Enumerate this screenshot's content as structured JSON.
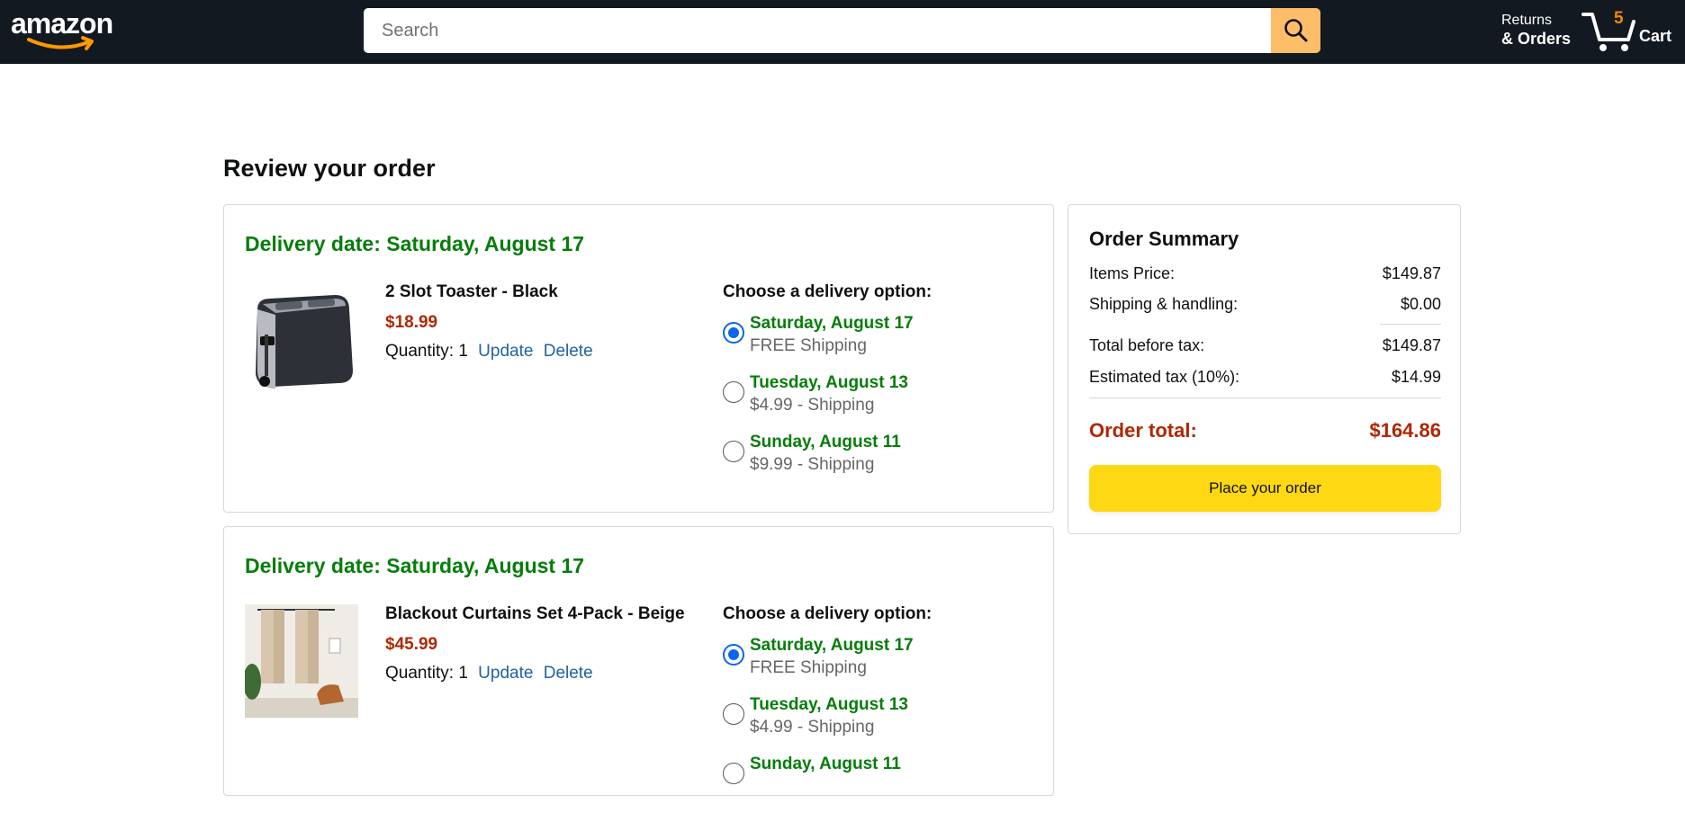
{
  "header": {
    "logo_text": "amazon",
    "search_placeholder": "Search",
    "returns_line1": "Returns",
    "returns_line2": "& Orders",
    "cart_count": "5",
    "cart_label": "Cart",
    "colors": {
      "bar": "#131921",
      "search_button": "#febd69",
      "cart_count": "#f08804"
    }
  },
  "page_title": "Review your order",
  "orders": [
    {
      "delivery_date": "Delivery date: Saturday, August 17",
      "product_name": "2 Slot Toaster - Black",
      "price": "$18.99",
      "quantity_label": "Quantity: 1",
      "update_label": "Update",
      "delete_label": "Delete",
      "image_icon": "toaster-image",
      "options_title": "Choose a delivery option:",
      "options": [
        {
          "date": "Saturday, August 17",
          "shipping": "FREE Shipping",
          "selected": true
        },
        {
          "date": "Tuesday, August 13",
          "shipping": "$4.99 - Shipping",
          "selected": false
        },
        {
          "date": "Sunday, August 11",
          "shipping": "$9.99 - Shipping",
          "selected": false
        }
      ]
    },
    {
      "delivery_date": "Delivery date: Saturday, August 17",
      "product_name": "Blackout Curtains Set 4-Pack - Beige",
      "price": "$45.99",
      "quantity_label": "Quantity: 1",
      "update_label": "Update",
      "delete_label": "Delete",
      "image_icon": "curtains-image",
      "options_title": "Choose a delivery option:",
      "options": [
        {
          "date": "Saturday, August 17",
          "shipping": "FREE Shipping",
          "selected": true
        },
        {
          "date": "Tuesday, August 13",
          "shipping": "$4.99 - Shipping",
          "selected": false
        },
        {
          "date": "Sunday, August 11",
          "shipping": "",
          "selected": false
        }
      ]
    }
  ],
  "summary": {
    "title": "Order Summary",
    "items_price_label": "Items Price:",
    "items_price_value": "$149.87",
    "shipping_label": "Shipping & handling:",
    "shipping_value": "$0.00",
    "before_tax_label": "Total before tax:",
    "before_tax_value": "$149.87",
    "tax_label": "Estimated tax (10%):",
    "tax_value": "$14.99",
    "total_label": "Order total:",
    "total_value": "$164.86",
    "place_order_label": "Place your order",
    "colors": {
      "total": "#b12704",
      "button": "#ffd814",
      "delivery_green": "#067d0b",
      "radio_selected": "#0a66e4"
    }
  }
}
